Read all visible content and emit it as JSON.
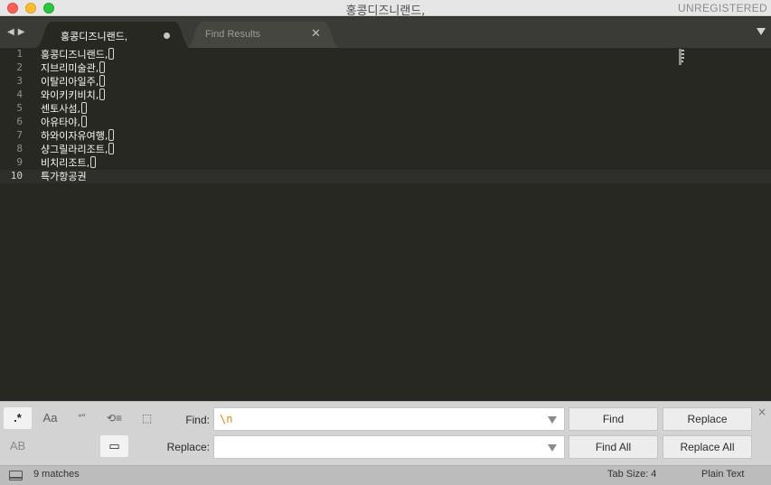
{
  "window": {
    "title": "홍콩디즈니랜드,",
    "registration": "UNREGISTERED"
  },
  "tabs": [
    {
      "label": "홍콩디즈니랜드,",
      "active": true,
      "modified": true
    },
    {
      "label": "Find Results",
      "active": false,
      "modified": false
    }
  ],
  "editor": {
    "current_line": 10,
    "lines": [
      {
        "number": "1",
        "text": "홍콩디즈니랜드,",
        "newline_match": true
      },
      {
        "number": "2",
        "text": "지브리미술관,",
        "newline_match": true
      },
      {
        "number": "3",
        "text": "이탈리아일주,",
        "newline_match": true
      },
      {
        "number": "4",
        "text": "와이키키비치,",
        "newline_match": true
      },
      {
        "number": "5",
        "text": "센토사섬,",
        "newline_match": true
      },
      {
        "number": "6",
        "text": "아유타야,",
        "newline_match": true
      },
      {
        "number": "7",
        "text": "하와이자유여행,",
        "newline_match": true
      },
      {
        "number": "8",
        "text": "샹그릴라리조트,",
        "newline_match": true
      },
      {
        "number": "9",
        "text": "비치리조트,",
        "newline_match": true
      },
      {
        "number": "10",
        "text": "특가항공권",
        "newline_match": false
      }
    ]
  },
  "find_panel": {
    "options": {
      "regex": ".*",
      "case": "Aa",
      "whole_word": "“”",
      "wrap": "⟲≡",
      "in_selection": "⬚",
      "preserve_case": "AB",
      "highlight": "▭"
    },
    "regex_enabled": true,
    "highlight_enabled": true,
    "find_label": "Find:",
    "find_value": "\\n",
    "replace_label": "Replace:",
    "replace_value": "",
    "buttons": {
      "find": "Find",
      "replace": "Replace",
      "find_all": "Find All",
      "replace_all": "Replace All"
    },
    "close": "×"
  },
  "status_bar": {
    "matches": "9 matches",
    "tab_size": "Tab Size: 4",
    "syntax": "Plain Text"
  },
  "icons": {
    "close": "close-traffic-light",
    "minimize": "minimize-traffic-light",
    "zoom": "zoom-traffic-light",
    "nav": "nav-arrows-icon",
    "tab_menu": "chevron-down-icon",
    "panel_switch": "panel-icon"
  },
  "colors": {
    "editor_bg": "#272822",
    "text": "#f8f8f2",
    "gutter_text": "#8f908a",
    "find_value": "#e8860c"
  }
}
